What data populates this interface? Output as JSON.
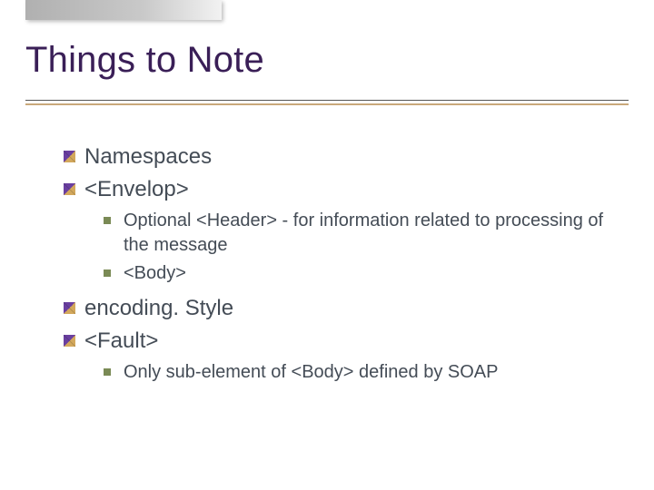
{
  "title": "Things to Note",
  "items": {
    "namespaces": "Namespaces",
    "envelop": "<Envelop>",
    "header": "Optional <Header> - for information related to processing of the message",
    "body": "<Body>",
    "encodingStyle": "encoding. Style",
    "fault": "<Fault>",
    "faultNote": "Only sub-element of <Body> defined by SOAP"
  }
}
